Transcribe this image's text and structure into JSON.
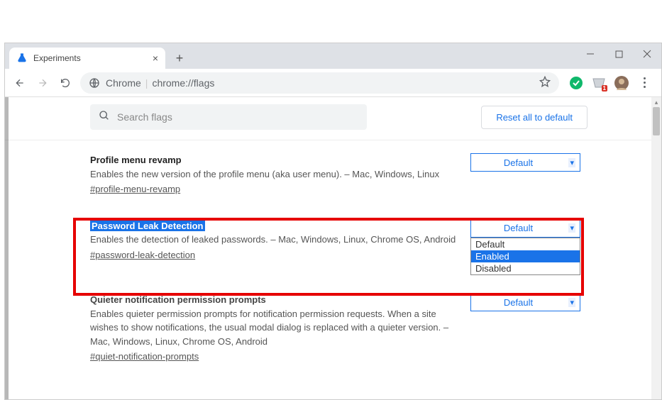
{
  "tab": {
    "title": "Experiments"
  },
  "address": {
    "prefix": "Chrome",
    "path": "chrome://flags"
  },
  "topbar": {
    "search_placeholder": "Search flags",
    "reset_label": "Reset all to default"
  },
  "flags": [
    {
      "title": "Profile menu revamp",
      "desc": "Enables the new version of the profile menu (aka user menu). – Mac, Windows, Linux",
      "hash": "#profile-menu-revamp",
      "selected": "Default",
      "highlighted": false
    },
    {
      "title": "Password Leak Detection",
      "desc": "Enables the detection of leaked passwords. – Mac, Windows, Linux, Chrome OS, Android",
      "hash": "#password-leak-detection",
      "selected": "Default",
      "highlighted": true,
      "dropdown_open": true,
      "options": [
        "Default",
        "Enabled",
        "Disabled"
      ],
      "hover_option": "Enabled"
    },
    {
      "title": "Quieter notification permission prompts",
      "desc": "Enables quieter permission prompts for notification permission requests. When a site wishes to show notifications, the usual modal dialog is replaced with a quieter version. – Mac, Windows, Linux, Chrome OS, Android",
      "hash": "#quiet-notification-prompts",
      "selected": "Default",
      "highlighted": false
    }
  ]
}
